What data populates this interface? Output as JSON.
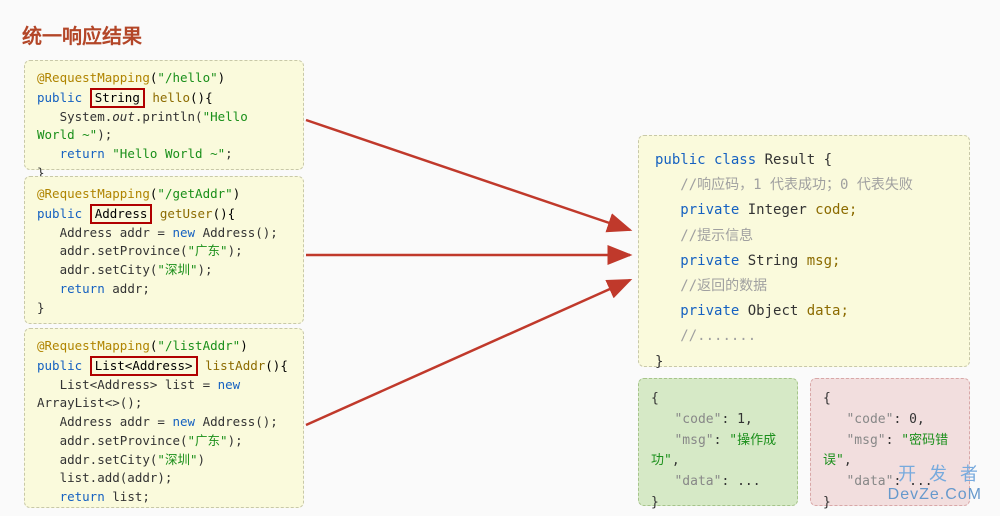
{
  "title": "统一响应结果",
  "blocks": {
    "b1": {
      "anno": "@RequestMapping",
      "annoArg": "\"/hello\"",
      "pub": "public",
      "rtype": "String",
      "mname": "hello",
      "l1a": "System.",
      "l1b": "out",
      "l1c": ".println(",
      "l1d": "\"Hello World ~\"",
      "l1e": ");",
      "ret": "return ",
      "retVal": "\"Hello World ~\"",
      "retEnd": ";",
      "close": "}"
    },
    "b2": {
      "anno": "@RequestMapping",
      "annoArg": "\"/getAddr\"",
      "pub": "public",
      "rtype": "Address",
      "mname": "getUser",
      "l1": "Address addr = ",
      "new": "new",
      "l1b": " Address();",
      "l2": "addr.setProvince(",
      "l2s": "\"广东\"",
      "l2e": ");",
      "l3": "addr.setCity(",
      "l3s": "\"深圳\"",
      "l3e": ");",
      "ret": "return ",
      "retVal": "addr;",
      "close": "}"
    },
    "b3": {
      "anno": "@RequestMapping",
      "annoArg": "\"/listAddr\"",
      "pub": "public",
      "rtype": "List<Address>",
      "mname": "listAddr",
      "l1": "List<Address> list = ",
      "new": "new",
      "l1b": " ArrayList<>();",
      "l2": "Address addr = ",
      "l2b": " Address();",
      "l3": "addr.setProvince(",
      "l3s": "\"广东\"",
      "l3e": ");",
      "l4": "addr.setCity(",
      "l4s": "\"深圳\"",
      "l4e": ")",
      "l5": "list.add(addr);",
      "ret": "return ",
      "retVal": "list;"
    },
    "result": {
      "pub": "public class",
      "cname": " Result {",
      "c1": "//响应码，1 代表成功；0 代表失败",
      "p1a": "private",
      "p1b": " Integer ",
      "p1c": "code;",
      "c2": "//提示信息",
      "p2a": "private",
      "p2b": " String ",
      "p2c": "msg;",
      "c3": "//返回的数据",
      "p3a": "private",
      "p3b": " Object ",
      "p3c": "data;",
      "c4": "//.......",
      "close": "}"
    },
    "jsonA": {
      "open": "{",
      "k1": "\"code\"",
      "v1": ": 1,",
      "k2": "\"msg\"",
      "v2a": ": ",
      "v2b": "\"操作成功\"",
      "v2c": ",",
      "k3": "\"data\"",
      "v3": ": ...",
      "close": "}"
    },
    "jsonB": {
      "open": "{",
      "k1": "\"code\"",
      "v1": ": 0,",
      "k2": "\"msg\"",
      "v2a": ": ",
      "v2b": "\"密码错误\"",
      "v2c": ",",
      "k3": "\"data\"",
      "v3": ": ...",
      "close": "}"
    }
  },
  "watermark": {
    "line1": "开 发 者",
    "line2": "DevZe.CoM"
  }
}
